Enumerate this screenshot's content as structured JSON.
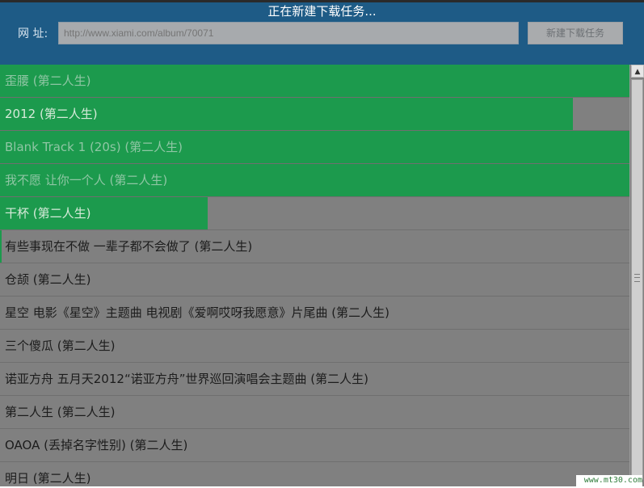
{
  "dialog": {
    "title": "正在新建下载任务...",
    "url_label": "网 址:",
    "url_placeholder": "http://www.xiami.com/album/70071",
    "submit_label": "新建下载任务"
  },
  "colors": {
    "header_bg": "#1e5b86",
    "progress_fill": "#1c9a4d",
    "list_bg": "#808080"
  },
  "tracks": [
    {
      "title": "歪腰 (第二人生)",
      "progress": 1.0
    },
    {
      "title": "2012 (第二人生)",
      "progress": 0.91
    },
    {
      "title": "Blank Track 1 (20s) (第二人生)",
      "progress": 1.0
    },
    {
      "title": "我不愿 让你一个人 (第二人生)",
      "progress": 1.0
    },
    {
      "title": "干杯 (第二人生)",
      "progress": 0.33
    },
    {
      "title": "有些事现在不做 一辈子都不会做了 (第二人生)",
      "progress": 0.003
    },
    {
      "title": "仓颉 (第二人生)",
      "progress": 0
    },
    {
      "title": "星空 电影《星空》主题曲 电视剧《爱啊哎呀我愿意》片尾曲 (第二人生)",
      "progress": 0
    },
    {
      "title": "三个傻瓜 (第二人生)",
      "progress": 0
    },
    {
      "title": "诺亚方舟 五月天2012“诺亚方舟”世界巡回演唱会主题曲 (第二人生)",
      "progress": 0
    },
    {
      "title": "第二人生 (第二人生)",
      "progress": 0
    },
    {
      "title": "OAOA (丢掉名字性别) (第二人生)",
      "progress": 0
    },
    {
      "title": "明日 (第二人生)",
      "progress": 0
    }
  ],
  "watermark": "www.mt30.com"
}
